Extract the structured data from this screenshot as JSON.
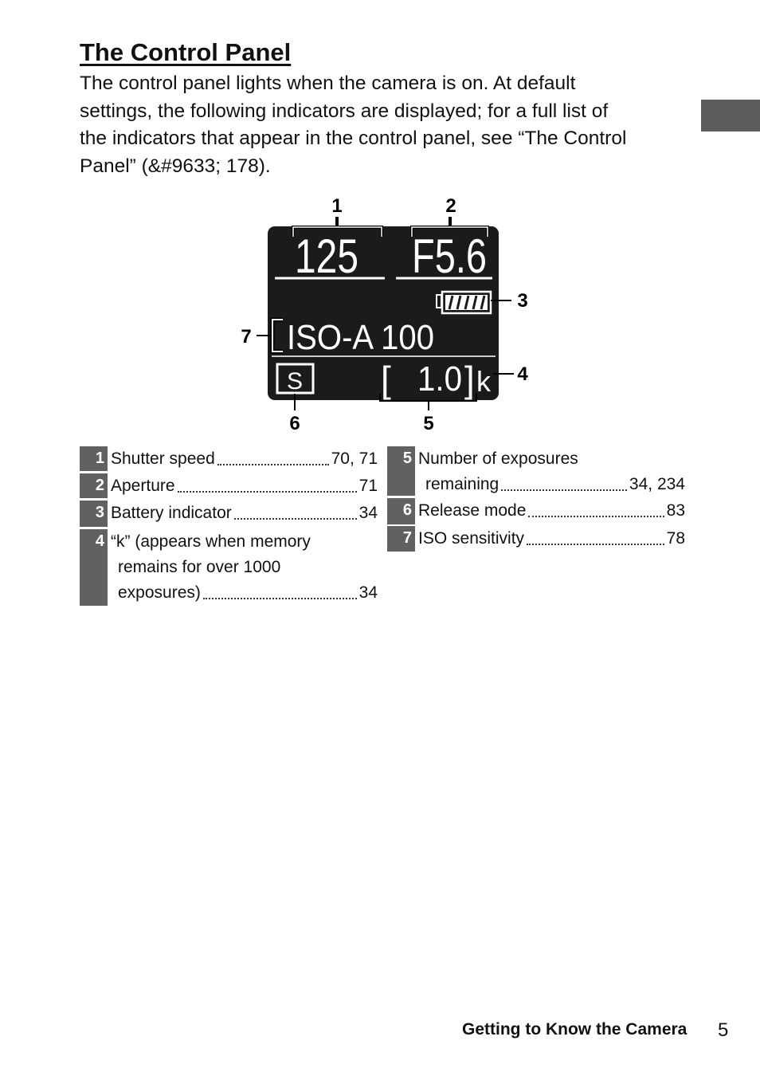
{
  "heading": "The Control Panel",
  "body_lines": [
    "The control panel lights when the camera is on. At default",
    "settings, the following indicators are displayed; for a full list of",
    "the indicators that appear in the control panel, see “The Control",
    "Panel” (&#9633; 178)."
  ],
  "body_ref_icon": "book-icon",
  "lcd": {
    "shutter": "125",
    "aperture": "F5.6",
    "iso": "ISO-A 100",
    "release_mode": "S",
    "exposures_open": "[",
    "exposures": "1.0",
    "exposures_close": "]",
    "k": "k",
    "callouts": [
      "1",
      "2",
      "3",
      "4",
      "5",
      "6",
      "7"
    ]
  },
  "legend": [
    {
      "num": "1",
      "lines": [
        "Shutter speed"
      ],
      "page": "70, 71"
    },
    {
      "num": "2",
      "lines": [
        "Aperture"
      ],
      "page": "71"
    },
    {
      "num": "3",
      "lines": [
        "Battery indicator"
      ],
      "page": "34"
    },
    {
      "num": "4",
      "lines": [
        "“k” (appears when memory",
        "remains for over 1000",
        "exposures)"
      ],
      "page": "34"
    },
    {
      "num": "5",
      "lines": [
        "Number of exposures",
        "remaining"
      ],
      "page": "34, 234"
    },
    {
      "num": "6",
      "lines": [
        "Release mode"
      ],
      "page": "83"
    },
    {
      "num": "7",
      "lines": [
        "ISO sensitivity"
      ],
      "page": "78"
    }
  ],
  "footer": {
    "section": "Getting to Know the Camera",
    "page": "5"
  }
}
